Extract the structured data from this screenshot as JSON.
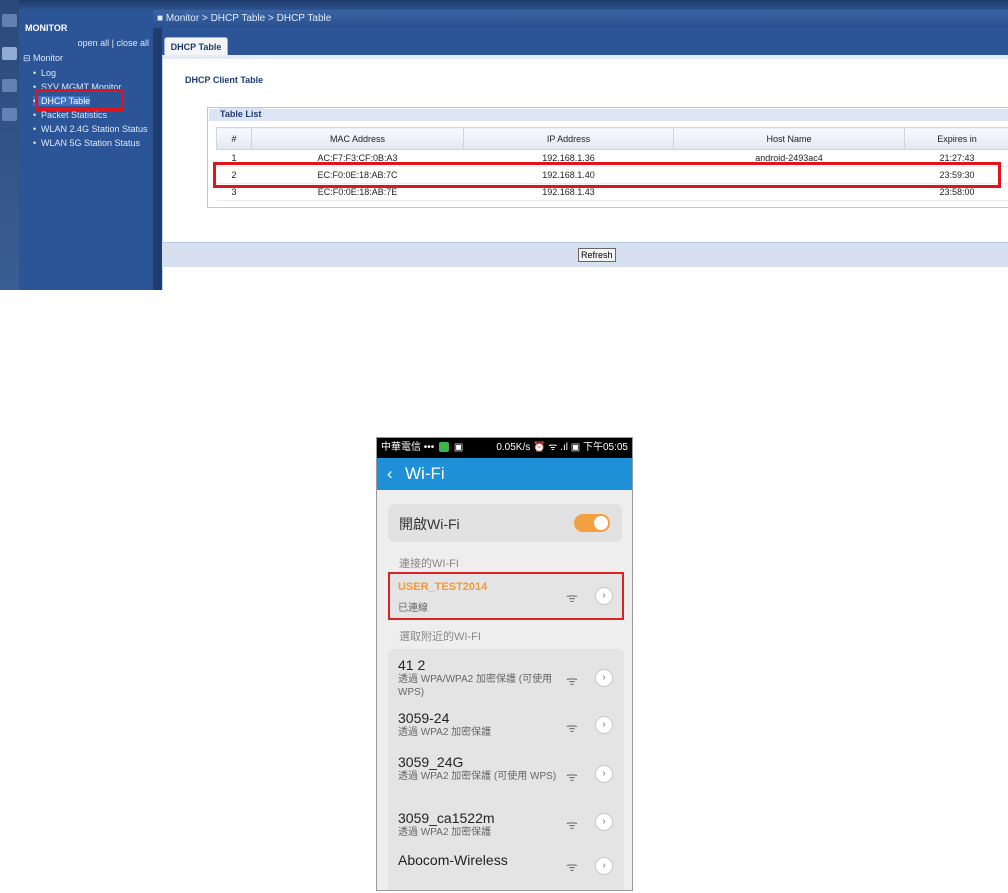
{
  "router": {
    "sidebar": {
      "title": "MONITOR",
      "open_all": "open all",
      "separator": "|",
      "close_all": "close all",
      "root": "Monitor",
      "items": [
        {
          "label": "Log"
        },
        {
          "label": "SYV MGMT Monitor"
        },
        {
          "label": "DHCP Table"
        },
        {
          "label": "Packet Statistics"
        },
        {
          "label": "WLAN 2.4G Station Status"
        },
        {
          "label": "WLAN 5G Station Status"
        }
      ]
    },
    "breadcrumb": "Monitor > DHCP Table > DHCP Table",
    "tab": "DHCP Table",
    "section_title": "DHCP Client Table",
    "table_legend": "Table List",
    "columns": [
      "#",
      "MAC Address",
      "IP Address",
      "Host Name",
      "Expires in"
    ],
    "rows": [
      {
        "num": "1",
        "mac": "AC:F7:F3:CF:0B:A3",
        "ip": "192.168.1.36",
        "host": "android-2493ac4",
        "expires": "21:27:43"
      },
      {
        "num": "2",
        "mac": "EC:F0:0E:18:AB:7C",
        "ip": "192.168.1.40",
        "host": "",
        "expires": "23:59:30"
      },
      {
        "num": "3",
        "mac": "EC:F0:0E:18:AB:7E",
        "ip": "192.168.1.43",
        "host": "",
        "expires": "23:58:00"
      }
    ],
    "refresh_label": "Refresh",
    "colors": {
      "highlight": "#e0141c",
      "sidebar": "#2b5597"
    }
  },
  "phone": {
    "status": {
      "carrier": "中華電信 •••",
      "speed": "0.05K/s",
      "icons": "⏰ ᯤ .ıl ▣",
      "time": "下午05:05"
    },
    "appbar": {
      "back": "‹",
      "title": "Wi-Fi"
    },
    "toggle_label": "開啟Wi-Fi",
    "toggle_on": true,
    "connected_section": "連接的WI-FI",
    "connected": {
      "name": "USER_TEST2014",
      "status": "已連線"
    },
    "nearby_section": "選取附近的WI-FI",
    "networks": [
      {
        "name": "41 2",
        "security": "透過 WPA/WPA2 加密保護 (可使用 WPS)"
      },
      {
        "name": "3059-24",
        "security": "透過 WPA2 加密保護"
      },
      {
        "name": "3059_24G",
        "security": "透過 WPA2 加密保護 (可使用 WPS)"
      },
      {
        "name": "3059_ca1522m",
        "security": "透過 WPA2 加密保護"
      },
      {
        "name": "Abocom-Wireless",
        "security": ""
      }
    ],
    "wifi_icon": "ᯤ",
    "chevron": "›",
    "colors": {
      "appbar": "#1e90d8",
      "toggle": "#f4a040",
      "connected_name": "#f09a3a",
      "highlight": "#d82424"
    }
  }
}
